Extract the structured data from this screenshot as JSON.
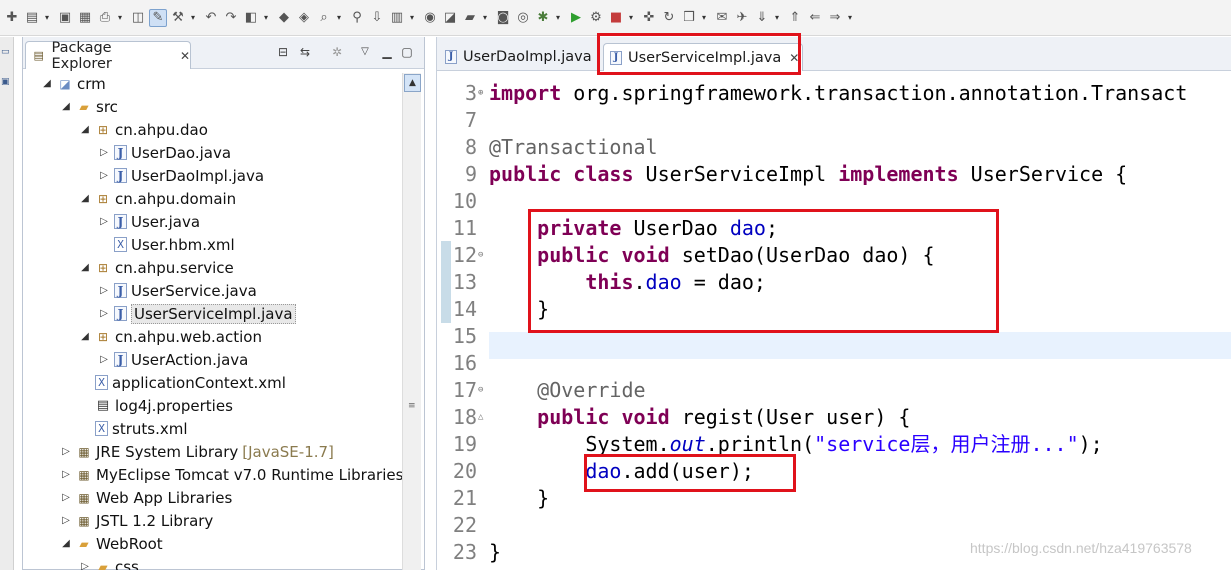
{
  "toolbar": {
    "icons": [
      "new-icon",
      "open-type-icon",
      "save-icon",
      "save-all-icon",
      "print-icon",
      "toggle-mark-icon",
      "toggle-breadcrumb-icon",
      "build-icon",
      "last-edit-icon",
      "back-history-icon",
      "new-java-project-icon",
      "new-package-icon",
      "new-class-icon",
      "open-search-icon",
      "search-icon",
      "deploy-icon",
      "server-icon",
      "web-browser-icon",
      "open-perspective-icon",
      "folder-icon",
      "screenshot-icon",
      "monitor-icon",
      "debug-icon",
      "run-icon",
      "run-external-icon",
      "stop-icon",
      "new-server-icon",
      "refresh-icon",
      "open-folder-icon",
      "open-task-icon",
      "pin-icon",
      "next-annotation-icon",
      "prev-annotation-icon",
      "back-icon",
      "forward-icon"
    ]
  },
  "explorer": {
    "title": "Package Explorer",
    "tree": [
      {
        "label": "crm",
        "type": "proj",
        "twisty": "open"
      },
      {
        "label": "src",
        "type": "srcfolder",
        "twisty": "open"
      },
      {
        "label": "cn.ahpu.dao",
        "type": "pkg",
        "twisty": "open"
      },
      {
        "label": "UserDao.java",
        "type": "java",
        "twisty": "closed"
      },
      {
        "label": "UserDaoImpl.java",
        "type": "java",
        "twisty": "closed"
      },
      {
        "label": "cn.ahpu.domain",
        "type": "pkg",
        "twisty": "open"
      },
      {
        "label": "User.java",
        "type": "java",
        "twisty": "closed"
      },
      {
        "label": "User.hbm.xml",
        "type": "xml",
        "twisty": ""
      },
      {
        "label": "cn.ahpu.service",
        "type": "pkg",
        "twisty": "open"
      },
      {
        "label": "UserService.java",
        "type": "java",
        "twisty": "closed"
      },
      {
        "label": "UserServiceImpl.java",
        "type": "java",
        "twisty": "closed",
        "selected": true
      },
      {
        "label": "cn.ahpu.web.action",
        "type": "pkg",
        "twisty": "open"
      },
      {
        "label": "UserAction.java",
        "type": "java",
        "twisty": "closed"
      },
      {
        "label": "applicationContext.xml",
        "type": "xml",
        "twisty": ""
      },
      {
        "label": "log4j.properties",
        "type": "prop",
        "twisty": ""
      },
      {
        "label": "struts.xml",
        "type": "xml",
        "twisty": ""
      },
      {
        "label": "JRE System Library",
        "decoration": "[JavaSE-1.7]",
        "type": "lib",
        "twisty": "closed"
      },
      {
        "label": "MyEclipse Tomcat v7.0 Runtime Libraries",
        "type": "lib",
        "twisty": "closed"
      },
      {
        "label": "Web App Libraries",
        "type": "lib",
        "twisty": "closed"
      },
      {
        "label": "JSTL 1.2 Library",
        "type": "lib",
        "twisty": "closed"
      },
      {
        "label": "WebRoot",
        "type": "folder",
        "twisty": "open"
      },
      {
        "label": "css",
        "type": "folder",
        "twisty": "closed"
      }
    ]
  },
  "editor": {
    "tabs": [
      {
        "label": "UserDaoImpl.java",
        "active": false
      },
      {
        "label": "UserServiceImpl.java",
        "active": true
      }
    ],
    "lines": [
      {
        "num": "3",
        "fold": "⊕",
        "segments": [
          {
            "t": "import ",
            "c": "kw"
          },
          {
            "t": "org.springframework.transaction.annotation.Transact",
            "c": ""
          }
        ]
      },
      {
        "num": "7",
        "fold": "",
        "segments": []
      },
      {
        "num": "8",
        "fold": "",
        "segments": [
          {
            "t": "@Transactional",
            "c": "ann"
          }
        ]
      },
      {
        "num": "9",
        "fold": "",
        "segments": [
          {
            "t": "public ",
            "c": "kw"
          },
          {
            "t": "class ",
            "c": "kw"
          },
          {
            "t": "UserServiceImpl ",
            "c": ""
          },
          {
            "t": "implements ",
            "c": "kw"
          },
          {
            "t": "UserService {",
            "c": ""
          }
        ]
      },
      {
        "num": "10",
        "fold": "",
        "segments": []
      },
      {
        "num": "11",
        "fold": "",
        "segments": [
          {
            "t": "    ",
            "c": ""
          },
          {
            "t": "private ",
            "c": "kw"
          },
          {
            "t": "UserDao ",
            "c": ""
          },
          {
            "t": "dao",
            "c": "fld"
          },
          {
            "t": ";",
            "c": ""
          }
        ]
      },
      {
        "num": "12",
        "fold": "⊖",
        "segments": [
          {
            "t": "    ",
            "c": ""
          },
          {
            "t": "public ",
            "c": "kw"
          },
          {
            "t": "void ",
            "c": "kw"
          },
          {
            "t": "setDao(UserDao dao) {",
            "c": ""
          }
        ]
      },
      {
        "num": "13",
        "fold": "",
        "segments": [
          {
            "t": "        ",
            "c": ""
          },
          {
            "t": "this",
            "c": "kw"
          },
          {
            "t": ".",
            "c": ""
          },
          {
            "t": "dao",
            "c": "fld"
          },
          {
            "t": " = dao;",
            "c": ""
          }
        ]
      },
      {
        "num": "14",
        "fold": "",
        "segments": [
          {
            "t": "    }",
            "c": ""
          }
        ]
      },
      {
        "num": "15",
        "fold": "",
        "segments": []
      },
      {
        "num": "16",
        "fold": "",
        "segments": []
      },
      {
        "num": "17",
        "fold": "⊖",
        "segments": [
          {
            "t": "    ",
            "c": ""
          },
          {
            "t": "@Override",
            "c": "ann"
          }
        ]
      },
      {
        "num": "18",
        "fold": "△",
        "segments": [
          {
            "t": "    ",
            "c": ""
          },
          {
            "t": "public ",
            "c": "kw"
          },
          {
            "t": "void ",
            "c": "kw"
          },
          {
            "t": "regist(User user) {",
            "c": ""
          }
        ]
      },
      {
        "num": "19",
        "fold": "",
        "segments": [
          {
            "t": "        System.",
            "c": ""
          },
          {
            "t": "out",
            "c": "sta"
          },
          {
            "t": ".println(",
            "c": ""
          },
          {
            "t": "\"service层，用户注册...\"",
            "c": "str"
          },
          {
            "t": ");",
            "c": ""
          }
        ]
      },
      {
        "num": "20",
        "fold": "",
        "segments": [
          {
            "t": "        ",
            "c": ""
          },
          {
            "t": "dao",
            "c": "fld"
          },
          {
            "t": ".add(user);",
            "c": ""
          }
        ]
      },
      {
        "num": "21",
        "fold": "",
        "segments": [
          {
            "t": "    }",
            "c": ""
          }
        ]
      },
      {
        "num": "22",
        "fold": "",
        "segments": []
      },
      {
        "num": "23",
        "fold": "",
        "segments": [
          {
            "t": "}",
            "c": ""
          }
        ]
      }
    ]
  },
  "watermark": "https://blog.csdn.net/hza419763578",
  "colors": {
    "highlight_box": "#e0121b",
    "keyword": "#7f0055",
    "field": "#0000c0",
    "string": "#2a00ff",
    "annotation": "#646464"
  }
}
